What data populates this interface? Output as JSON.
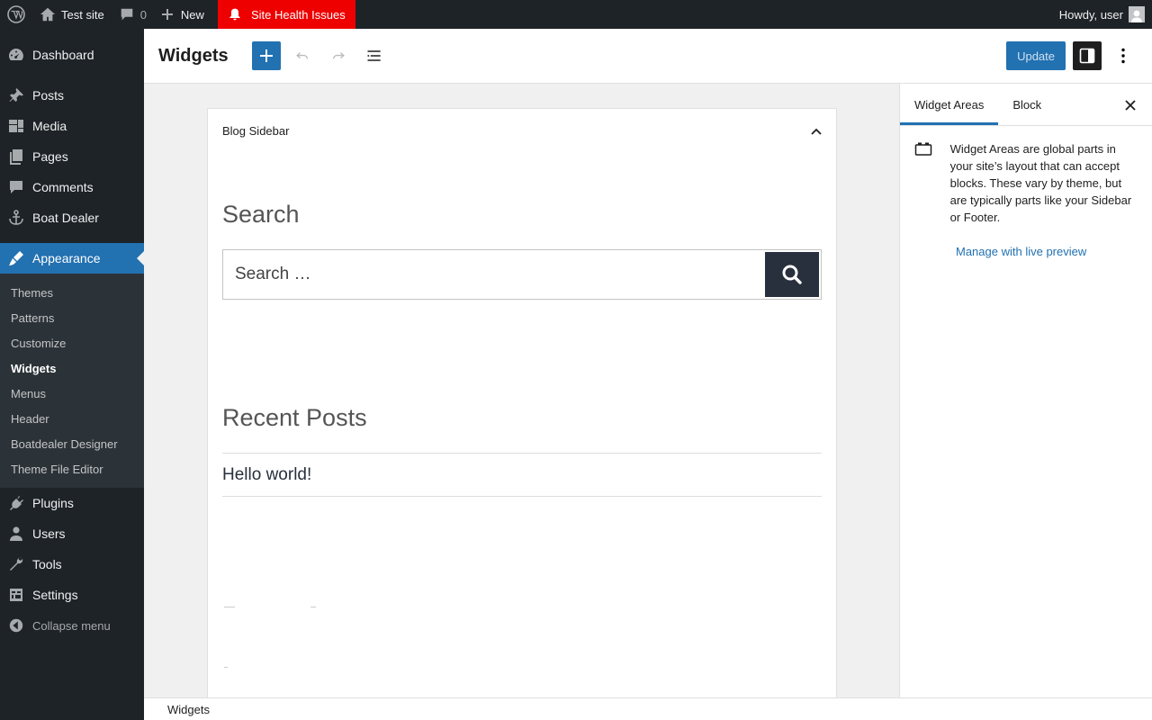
{
  "admin_bar": {
    "site_name": "Test site",
    "comments_count": "0",
    "new_label": "New",
    "health_label": "Site Health Issues",
    "howdy": "Howdy, user"
  },
  "menu": {
    "items_top": [
      {
        "label": "Dashboard",
        "icon": "dashboard-icon"
      },
      {
        "label": "Posts",
        "icon": "pin-icon"
      },
      {
        "label": "Media",
        "icon": "media-icon"
      },
      {
        "label": "Pages",
        "icon": "pages-icon"
      },
      {
        "label": "Comments",
        "icon": "comment-icon"
      },
      {
        "label": "Boat Dealer",
        "icon": "anchor-icon"
      }
    ],
    "current": {
      "label": "Appearance",
      "icon": "paintbrush-icon"
    },
    "submenu": [
      "Themes",
      "Patterns",
      "Customize",
      "Widgets",
      "Menus",
      "Header",
      "Boatdealer Designer",
      "Theme File Editor"
    ],
    "submenu_active": "Widgets",
    "items_bottom": [
      {
        "label": "Plugins",
        "icon": "plugin-icon"
      },
      {
        "label": "Users",
        "icon": "user-icon"
      },
      {
        "label": "Tools",
        "icon": "wrench-icon"
      },
      {
        "label": "Settings",
        "icon": "settings-icon"
      }
    ],
    "collapse_label": "Collapse menu"
  },
  "header": {
    "title": "Widgets",
    "update_label": "Update"
  },
  "canvas": {
    "area_title": "Blog Sidebar",
    "search_heading": "Search",
    "search_placeholder": "Search …",
    "recent_heading": "Recent Posts",
    "recent_items": [
      "Hello world!"
    ]
  },
  "sidebar": {
    "tabs": [
      "Widget Areas",
      "Block"
    ],
    "active_tab": "Widget Areas",
    "description": "Widget Areas are global parts in your site’s layout that can accept blocks. These vary by theme, but are typically parts like your Sidebar or Footer.",
    "live_preview_label": "Manage with live preview"
  },
  "footer": {
    "breadcrumb": "Widgets"
  },
  "colors": {
    "accent": "#2271b1",
    "admin_bg": "#1d2327",
    "health_alert": "#ee0000"
  }
}
